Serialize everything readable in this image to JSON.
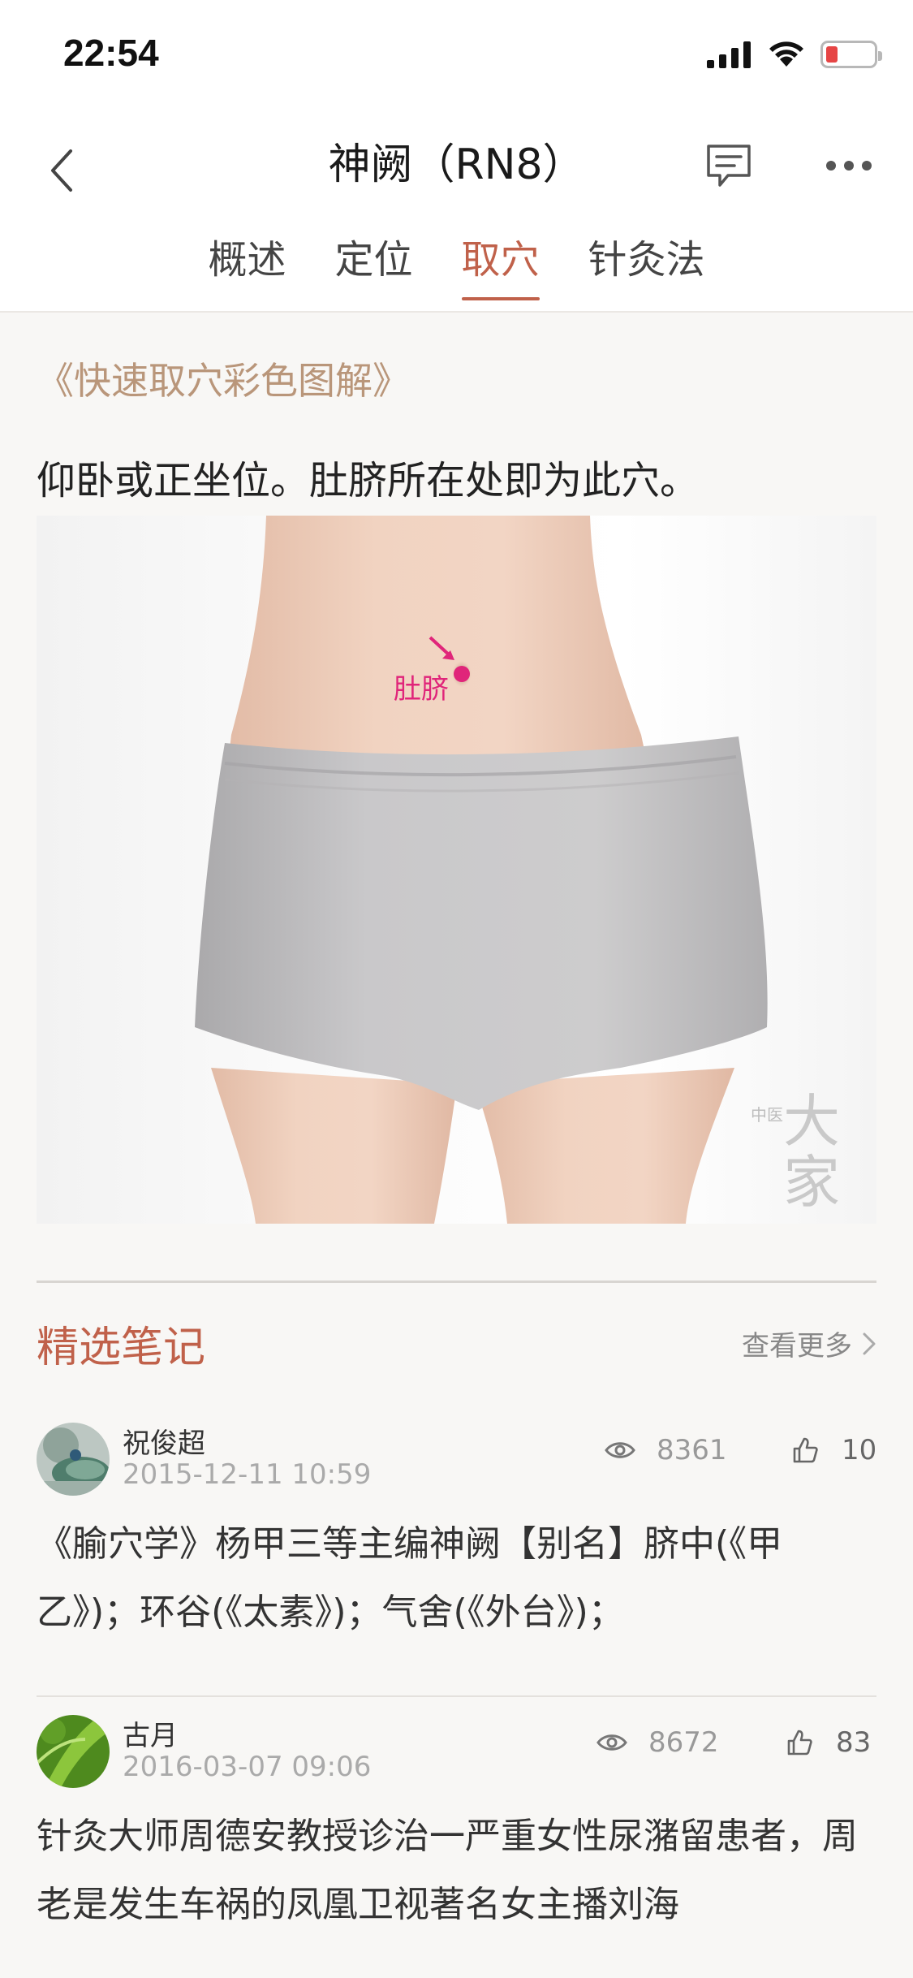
{
  "status_bar": {
    "time": "22:54",
    "battery_color": "#e64545"
  },
  "nav": {
    "title": "神阙（RN8）",
    "back_icon": "chevron-left-icon",
    "comment_icon": "comment-icon",
    "more_icon": "more-icon"
  },
  "tabs": [
    {
      "label": "概述",
      "active": false
    },
    {
      "label": "定位",
      "active": false
    },
    {
      "label": "取穴",
      "active": true
    },
    {
      "label": "针灸法",
      "active": false
    }
  ],
  "accent_color": "#c0614a",
  "source_ref": "《快速取穴彩色图解》",
  "description": "仰卧或正坐位。肚脐所在处即为此穴。",
  "illustration": {
    "marker_label": "肚脐",
    "marker_color": "#e0257a",
    "watermark_small": "中医",
    "watermark_big_1": "大",
    "watermark_big_2": "家"
  },
  "notes": {
    "title": "精选笔记",
    "see_more": "查看更多",
    "items": [
      {
        "author": "祝俊超",
        "date": "2015-12-11 10:59",
        "views": "8361",
        "likes": "10",
        "text": "《腧穴学》杨甲三等主编神阙【别名】脐中(《甲乙》)；环谷(《太素》)；气舍(《外台》)；"
      },
      {
        "author": "古月",
        "date": "2016-03-07 09:06",
        "views": "8672",
        "likes": "83",
        "text": "针灸大师周德安教授诊治一严重女性尿潴留患者，周老是发生车祸的凤凰卫视著名女主播刘海"
      }
    ]
  }
}
